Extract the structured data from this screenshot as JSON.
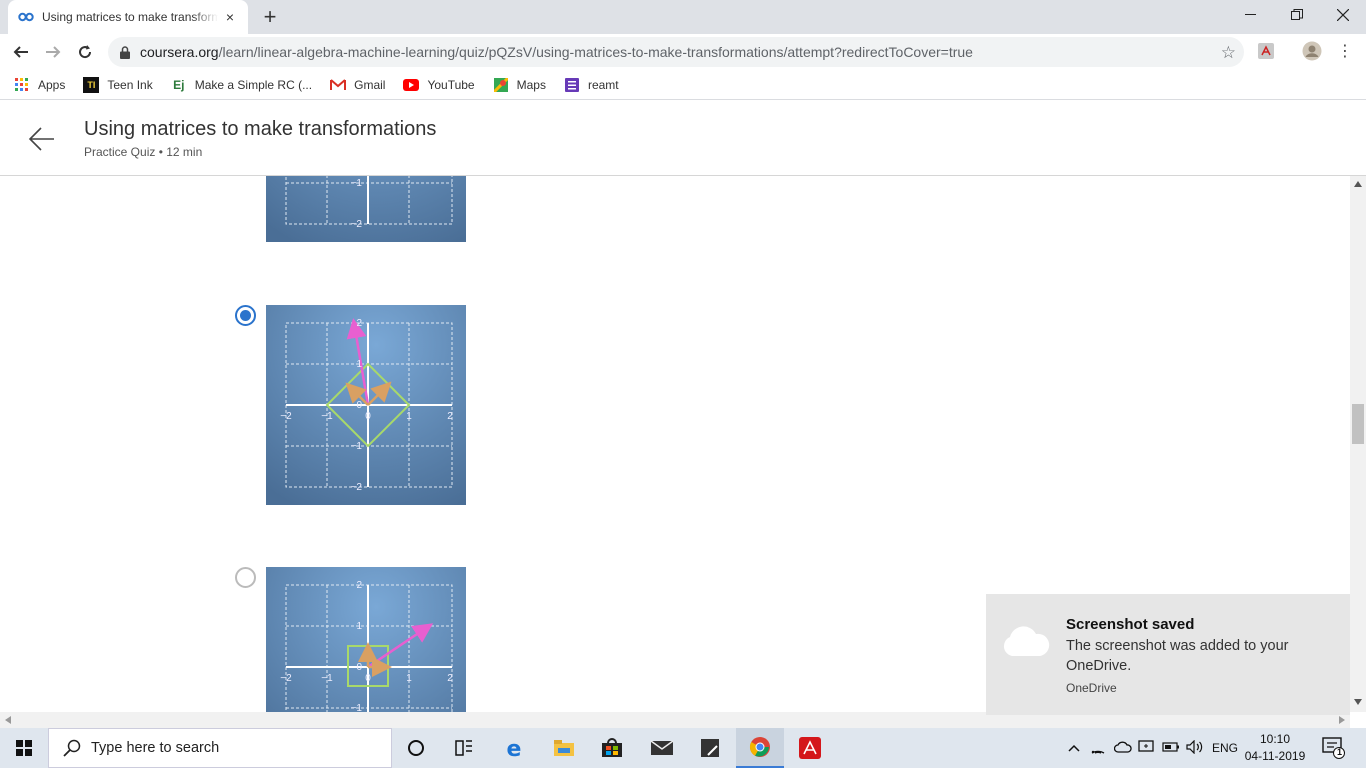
{
  "browser": {
    "tab_title": "Using matrices to make transformations",
    "tab_close": "×",
    "new_tab": "+",
    "url_domain": "coursera.org",
    "url_path": "/learn/linear-algebra-machine-learning/quiz/pQZsV/using-matrices-to-make-transformations/attempt?redirectToCover=true",
    "bookmarks": [
      {
        "label": "Apps",
        "icon": "apps-grid-icon"
      },
      {
        "label": "Teen Ink",
        "icon": "teen-ink-icon"
      },
      {
        "label": "Make a Simple RC (...",
        "icon": "ej-icon"
      },
      {
        "label": "Gmail",
        "icon": "gmail-icon"
      },
      {
        "label": "YouTube",
        "icon": "youtube-icon"
      },
      {
        "label": "Maps",
        "icon": "maps-icon"
      },
      {
        "label": "reamt",
        "icon": "forms-icon"
      }
    ]
  },
  "page": {
    "title": "Using matrices to make transformations",
    "subtitle": "Practice Quiz • 12 min"
  },
  "options": [
    {
      "selected": false
    },
    {
      "selected": true
    },
    {
      "selected": false
    }
  ],
  "plot_ticks": {
    "neg2": "−2",
    "neg1": "−1",
    "zero": "0",
    "one": "1",
    "two": "2"
  },
  "toast": {
    "title": "Screenshot saved",
    "body": "The screenshot was added to your OneDrive.",
    "source": "OneDrive"
  },
  "taskbar": {
    "search_placeholder": "Type here to search",
    "language": "ENG",
    "time": "10:10",
    "date": "04-11-2019",
    "notification_count": "1"
  },
  "colors": {
    "plot_bg": "#5a82ad",
    "vector_pink": "#e85fd0",
    "vector_tan": "#d9a062",
    "shape_green": "#a8d96a",
    "radio_selected": "#2a73cc"
  }
}
